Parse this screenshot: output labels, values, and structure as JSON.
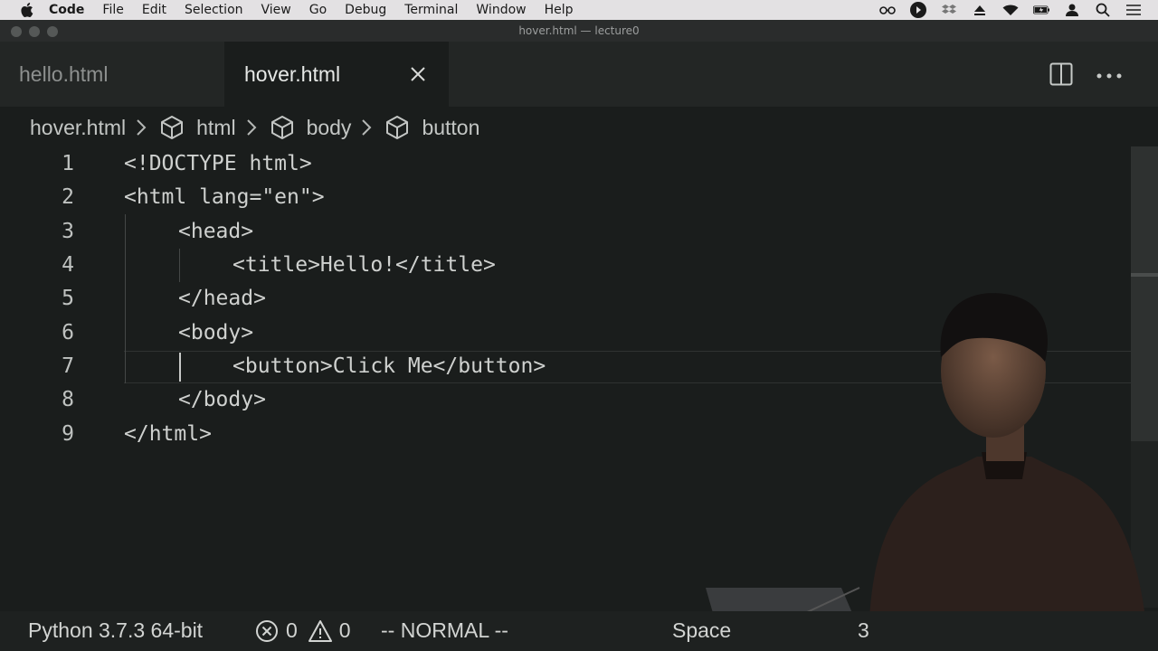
{
  "menubar": {
    "app_name": "Code",
    "items": [
      "File",
      "Edit",
      "Selection",
      "View",
      "Go",
      "Debug",
      "Terminal",
      "Window",
      "Help"
    ],
    "status_icons": [
      "glasses-icon",
      "play-circle-icon",
      "dropbox-icon",
      "eject-icon",
      "wifi-icon",
      "battery-icon",
      "user-icon",
      "search-icon",
      "list-icon"
    ]
  },
  "window": {
    "title": "hover.html — lecture0"
  },
  "tabs": [
    {
      "label": "hello.html",
      "active": false
    },
    {
      "label": "hover.html",
      "active": true
    }
  ],
  "breadcrumb": {
    "file": "hover.html",
    "items": [
      "html",
      "body",
      "button"
    ]
  },
  "editor": {
    "lines": [
      {
        "number": "1",
        "text": "<!DOCTYPE html>"
      },
      {
        "number": "2",
        "text": "<html lang=\"en\">"
      },
      {
        "number": "3",
        "text": "<head>"
      },
      {
        "number": "4",
        "text": "<title>Hello!</title>"
      },
      {
        "number": "5",
        "text": "</head>"
      },
      {
        "number": "6",
        "text": "<body>"
      },
      {
        "number": "7",
        "text": "<button>Click Me</button>"
      },
      {
        "number": "8",
        "text": "</body>"
      },
      {
        "number": "9",
        "text": "</html>"
      }
    ],
    "current_line": 7
  },
  "statusbar": {
    "interpreter": "Python 3.7.3 64-bit",
    "errors": "0",
    "warnings": "0",
    "vim_mode": "-- NORMAL --",
    "indentation": "Space",
    "trailing": "3"
  },
  "colors": {
    "editor_bg": "#1a1d1c",
    "tab_bar_bg": "#232625",
    "menubar_bg": "#e3e1e3"
  }
}
